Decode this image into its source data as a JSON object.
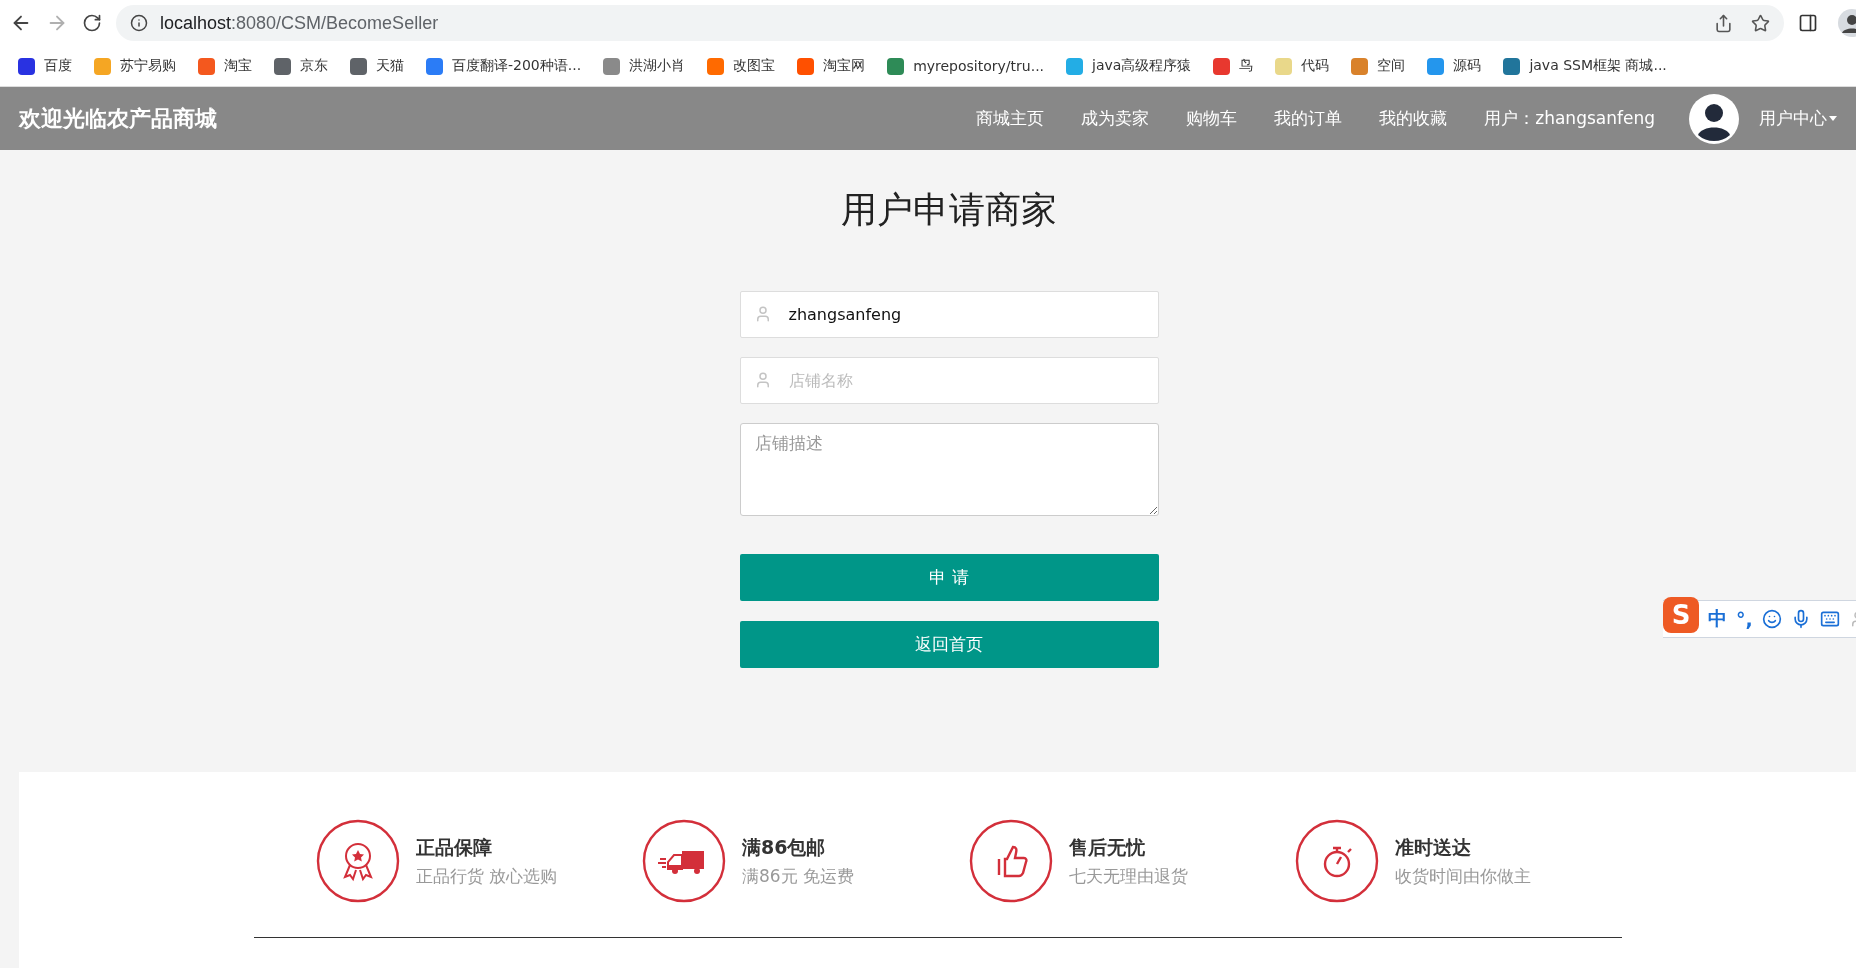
{
  "browser": {
    "url_host": "localhost",
    "url_path": ":8080/CSM/BecomeSeller",
    "bookmarks": [
      {
        "label": "百度",
        "color": "#2932e1"
      },
      {
        "label": "苏宁易购",
        "color": "#f5a623"
      },
      {
        "label": "淘宝",
        "color": "#f4581e"
      },
      {
        "label": "京东",
        "color": "#5f6368"
      },
      {
        "label": "天猫",
        "color": "#5f6368"
      },
      {
        "label": "百度翻译-200种语...",
        "color": "#2b7cf6"
      },
      {
        "label": "洪湖小肖",
        "color": "#8a8a8a"
      },
      {
        "label": "改图宝",
        "color": "#ff6a00"
      },
      {
        "label": "淘宝网",
        "color": "#ff5000"
      },
      {
        "label": "myrepository/tru...",
        "color": "#2e8b57"
      },
      {
        "label": "java高级程序猿",
        "color": "#23ade5"
      },
      {
        "label": "鸟",
        "color": "#e8382f"
      },
      {
        "label": "代码",
        "color": "#e9d88a"
      },
      {
        "label": "空间",
        "color": "#d9822b"
      },
      {
        "label": "源码",
        "color": "#2496ed"
      },
      {
        "label": "java SSM框架 商城...",
        "color": "#21759b"
      }
    ]
  },
  "nav": {
    "brand": "欢迎光临农产品商城",
    "links": [
      "商城主页",
      "成为卖家",
      "购物车",
      "我的订单",
      "我的收藏"
    ],
    "user_label": "用户：zhangsanfeng",
    "user_menu": "用户中心"
  },
  "page_title": "用户申请商家",
  "form": {
    "username": "zhangsanfeng",
    "shop_name_placeholder": "店铺名称",
    "description_placeholder": "店铺描述",
    "buttons": [
      "申 请",
      "返回首页"
    ]
  },
  "features": [
    {
      "kind": "award",
      "title": "正品保障",
      "subtitle": "正品行货 放心选购"
    },
    {
      "kind": "truck",
      "title": "满86包邮",
      "subtitle": "满86元 免运费"
    },
    {
      "kind": "thumb",
      "title": "售后无忧",
      "subtitle": "七天无理由退货"
    },
    {
      "kind": "timer",
      "title": "准时送达",
      "subtitle": "收货时间由你做主"
    }
  ],
  "ime": {
    "logo": "S",
    "mode": "中",
    "punct": "°,"
  }
}
